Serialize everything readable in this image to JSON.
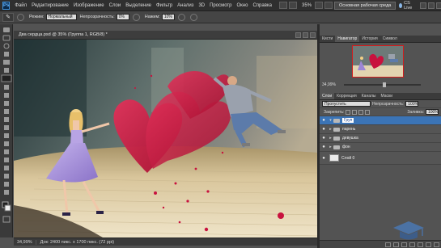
{
  "menubar": {
    "logo": "Ps",
    "items": [
      "Файл",
      "Редактирование",
      "Изображение",
      "Слои",
      "Выделение",
      "Фильтр",
      "Анализ",
      "3D",
      "Просмотр",
      "Окно",
      "Справка"
    ],
    "zoom": "35%",
    "workspace_button": "Основная рабочая среда",
    "cs_live": "CS Live"
  },
  "options": {
    "mode_label": "Режим:",
    "mode_value": "Нормальный",
    "opacity_label": "Непрозрачность:",
    "opacity_value": "0%",
    "flow_label": "Нажим:",
    "flow_value": "10%"
  },
  "document": {
    "tab_title": "Два сердца.psd @ 35% (Группа 1, RGB/8) *",
    "status_zoom": "34,99%",
    "status_info": "Док: 2400 пикс. x 1700 пикс. (72 ppi)"
  },
  "navigator": {
    "tabs": [
      "Кисти",
      "Навигатор",
      "История",
      "Символ"
    ],
    "active_tab": "Навигатор",
    "zoom": "34,99%"
  },
  "layers": {
    "tabs": [
      "Слои",
      "Коррекция",
      "Каналы",
      "Маски"
    ],
    "blend_mode": "Пропустить",
    "opacity_label": "Непрозрачность:",
    "opacity_value": "100%",
    "lock_label": "Закрепить:",
    "fill_label": "Заливка:",
    "fill_value": "100%",
    "rows": [
      {
        "name": "Груп",
        "selected": true
      },
      {
        "name": "парень",
        "selected": false
      },
      {
        "name": "девушка",
        "selected": false
      },
      {
        "name": "фон",
        "selected": false
      },
      {
        "name": "Слой 0",
        "selected": false
      }
    ]
  },
  "colors": {
    "accent": "#3b74b6",
    "heart": "#c8123e",
    "dress": "#9d86d6"
  }
}
